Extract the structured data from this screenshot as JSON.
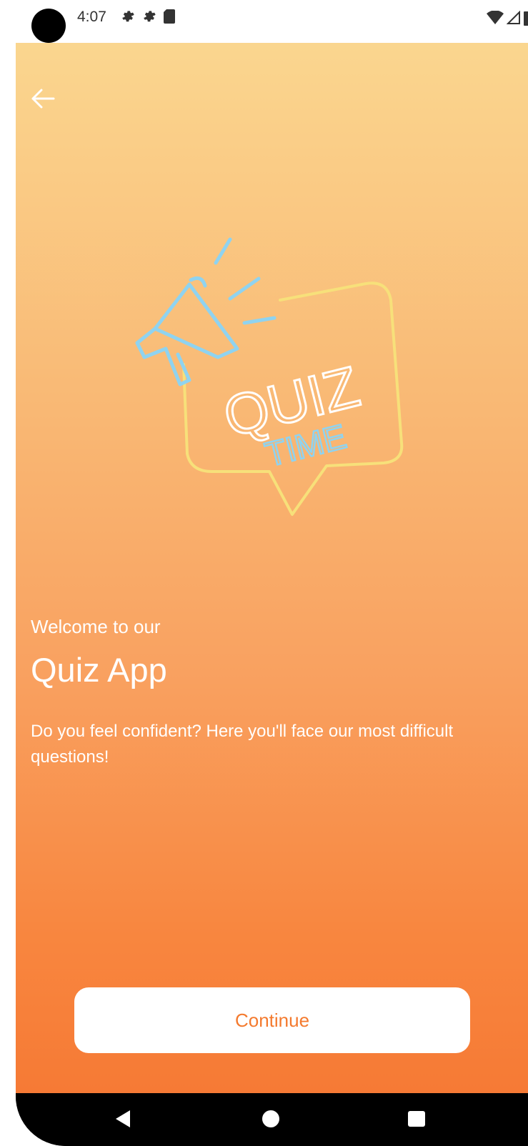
{
  "status_bar": {
    "time": "4:07",
    "left_icons": [
      "gear-icon",
      "gear-icon",
      "sd-card-icon"
    ],
    "right_icons": [
      "wifi-icon",
      "signal-icon",
      "battery-icon"
    ]
  },
  "header": {
    "back_icon": "arrow-left-icon"
  },
  "illustration": {
    "line1": "QUIZ",
    "line2": "TIME"
  },
  "content": {
    "welcome": "Welcome to our",
    "title": "Quiz App",
    "description": "Do you feel confident? Here you'll face our most difficult questions!"
  },
  "actions": {
    "continue_label": "Continue"
  },
  "theme": {
    "gradient_top": "#fad68f",
    "gradient_bottom": "#f67a35",
    "button_text": "#f47a2e",
    "neon_blue": "#8fd3f0",
    "neon_yellow": "#f7e07a"
  },
  "nav_bar": {
    "icons": [
      "nav-back-icon",
      "nav-home-icon",
      "nav-recents-icon"
    ]
  }
}
